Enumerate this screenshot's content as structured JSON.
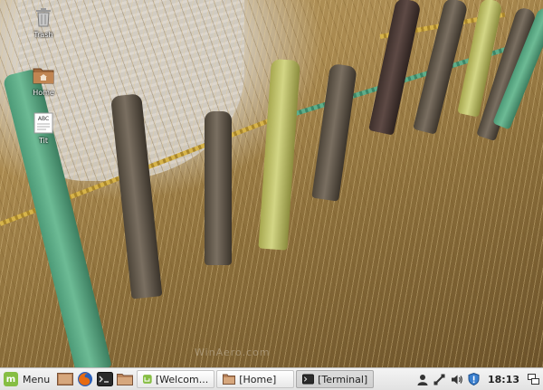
{
  "desktop": {
    "icons": [
      {
        "name": "trash-icon",
        "label": "Trash"
      },
      {
        "name": "home-folder-icon",
        "label": "Home"
      },
      {
        "name": "text-file-icon",
        "label": "Tit",
        "glyph_text": "ABC"
      }
    ],
    "watermark": "WinAero.com"
  },
  "panel": {
    "menu_label": "Menu",
    "launchers": [
      {
        "name": "show-desktop-icon"
      },
      {
        "name": "firefox-icon"
      },
      {
        "name": "terminal-icon"
      },
      {
        "name": "files-icon"
      }
    ],
    "windows": [
      {
        "label": "[Welcom...",
        "icon": "mint-welcome-icon",
        "active": false
      },
      {
        "label": "[Home]",
        "icon": "folder-icon",
        "active": false
      },
      {
        "label": "[Terminal]",
        "icon": "terminal-icon",
        "active": true
      }
    ],
    "tray": [
      {
        "name": "user-icon"
      },
      {
        "name": "network-icon"
      },
      {
        "name": "volume-icon"
      },
      {
        "name": "update-shield-icon"
      }
    ],
    "clock": "18:13"
  },
  "colors": {
    "mint_green": "#86be43",
    "panel_bg": "#ececec"
  }
}
